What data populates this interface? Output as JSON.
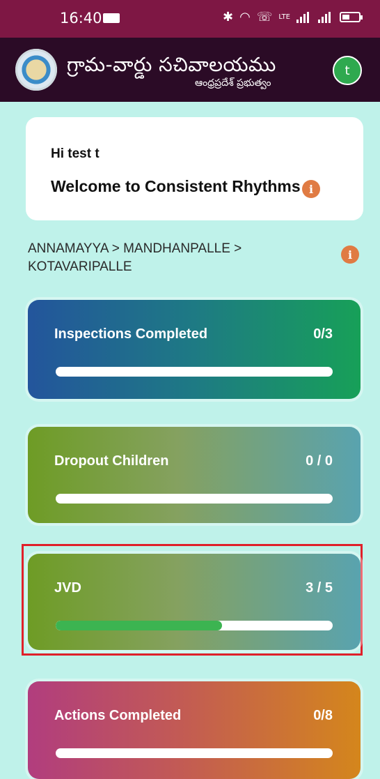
{
  "status_bar": {
    "time": "16:40",
    "network_label": "LTE"
  },
  "app_bar": {
    "title": "గ్రామ-వార్డు సచివాలయము",
    "subtitle": "ఆంధ్రప్రదేశ్ ప్రభుత్వం",
    "avatar_letter": "t",
    "logo_icon": "ap-emblem-icon"
  },
  "welcome": {
    "greeting": "Hi test t",
    "title": "Welcome to Consistent Rhythms"
  },
  "location": {
    "path": "ANNAMAYYA > MANDHANPALLE > KOTAVARIPALLE"
  },
  "cards": [
    {
      "title": "Inspections Completed",
      "value": "0/3",
      "progress": 0
    },
    {
      "title": "Dropout Children",
      "value": "0 / 0",
      "progress": 0
    },
    {
      "title": "JVD",
      "value": "3 / 5",
      "progress": 0.6
    },
    {
      "title": "Actions Completed",
      "value": "0/8",
      "progress": 0
    }
  ],
  "colors": {
    "status_bar": "#7e1744",
    "app_bar": "#2b0b26",
    "background": "#bff2ea",
    "progress_fill": "#3cb451",
    "info_icon": "#e07b43",
    "highlight": "#e0202a"
  }
}
